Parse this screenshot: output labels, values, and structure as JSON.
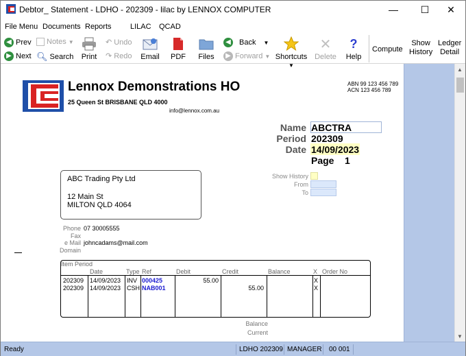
{
  "window": {
    "title": "Debtor_ Statement - LDHO - 202309 - lilac by LENNOX COMPUTER",
    "minimize": "—",
    "maximize": "☐",
    "close": "✕"
  },
  "menu": {
    "items": [
      "File Menu",
      "Documents",
      "Reports",
      "LILAC",
      "QCAD"
    ]
  },
  "toolbar": {
    "prev": "Prev",
    "next": "Next",
    "notes": "Notes",
    "search": "Search",
    "print": "Print",
    "undo": "Undo",
    "redo": "Redo",
    "email": "Email",
    "pdf": "PDF",
    "files": "Files",
    "back": "Back",
    "forward": "Forward",
    "shortcuts": "Shortcuts",
    "delete": "Delete",
    "help": "Help",
    "compute": "Compute",
    "show_history_1": "Show",
    "show_history_2": "History",
    "ledger_detail_1": "Ledger",
    "ledger_detail_2": "Detail"
  },
  "statement": {
    "company": "Lennox Demonstrations HO",
    "address": "25 Queen St BRISBANE QLD 4000",
    "email": "info@lennox.com.au",
    "abn": "ABN 99 123 456 789",
    "acn": "ACN 123 456 789",
    "name_label": "Name",
    "name_value": "ABCTRA",
    "period_label": "Period",
    "period_value": "202309",
    "date_label": "Date",
    "date_value": "14/09/2023",
    "page_label": "Page",
    "page_value": "1",
    "recipient": {
      "line1": "ABC Trading Pty Ltd",
      "line2": "12 Main St",
      "line3": "MILTON QLD 4064"
    },
    "show_history_label": "Show History",
    "from_label": "From",
    "to_label": "To",
    "phone_label": "Phone",
    "phone_value": "07 30005555",
    "fax_label": "Fax",
    "email_label": "e Mail",
    "email_value": "johncadams@mail.com",
    "domain_label": "Domain",
    "table": {
      "group_label": "Item Period",
      "headers": [
        "Date",
        "Type",
        "Ref",
        "Debit",
        "Credit",
        "Balance",
        "X",
        "Order No"
      ],
      "rows": [
        {
          "period": "202309",
          "date": "14/09/2023",
          "type": "INV",
          "ref": "000425",
          "debit": "55.00",
          "credit": "",
          "x": "X"
        },
        {
          "period": "202309",
          "date": "14/09/2023",
          "type": "CSH",
          "ref": "NAB001",
          "debit": "",
          "credit": "55.00",
          "x": "X"
        }
      ]
    },
    "balance_label": "Balance",
    "current_label": "Current"
  },
  "status": {
    "ready": "Ready",
    "ledger": "LDHO 202309",
    "user": "MANAGER",
    "code": "00 001"
  },
  "colors": {
    "accent_panel": "#b4c7e7",
    "ref_link": "#1b1bd0",
    "highlight_yellow": "#ffffc4"
  }
}
